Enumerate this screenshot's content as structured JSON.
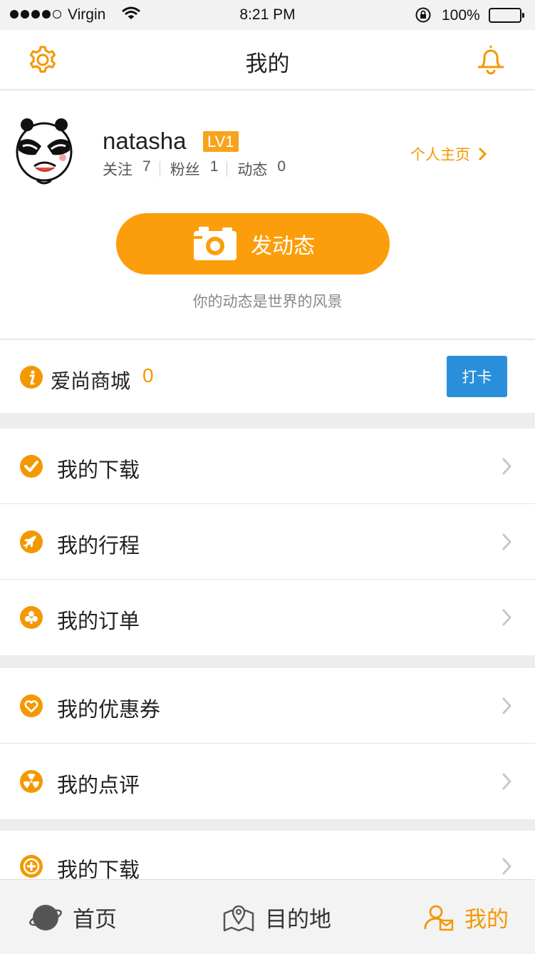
{
  "status_bar": {
    "carrier": "Virgin",
    "time": "8:21 PM",
    "battery": "100%",
    "signal_bars": 4,
    "icons": [
      "signal-dots-icon",
      "wifi-icon",
      "rotation-lock-icon",
      "battery-icon"
    ]
  },
  "nav": {
    "title": "我的",
    "left_icon": "settings-gear-icon",
    "right_icon": "bell-icon"
  },
  "profile": {
    "username": "natasha",
    "level": "LV1",
    "stats": [
      {
        "label": "关注",
        "value": "7"
      },
      {
        "label": "粉丝",
        "value": "1"
      },
      {
        "label": "动态",
        "value": "0"
      }
    ],
    "home_link": "个人主页",
    "post_button": "发动态",
    "post_hint": "你的动态是世界的风景"
  },
  "mall": {
    "label": "爱尚商城",
    "count": "0",
    "checkin_button": "打卡"
  },
  "menu_groups": [
    [
      {
        "label": "我的下载",
        "icon": "check-icon"
      },
      {
        "label": "我的行程",
        "icon": "plane-icon"
      },
      {
        "label": "我的订单",
        "icon": "club-icon"
      }
    ],
    [
      {
        "label": "我的优惠券",
        "icon": "heart-icon"
      },
      {
        "label": "我的点评",
        "icon": "radiation-icon"
      }
    ],
    [
      {
        "label": "我的下载",
        "icon": "plus-icon"
      }
    ]
  ],
  "tabs": [
    {
      "label": "首页",
      "icon": "planet-icon",
      "active": false
    },
    {
      "label": "目的地",
      "icon": "map-pin-icon",
      "active": false
    },
    {
      "label": "我的",
      "icon": "user-mail-icon",
      "active": true
    }
  ],
  "colors": {
    "accent": "#f39800",
    "button_orange": "#fc9e0b",
    "checkin_blue": "#2a8fda",
    "background": "#ededed"
  }
}
